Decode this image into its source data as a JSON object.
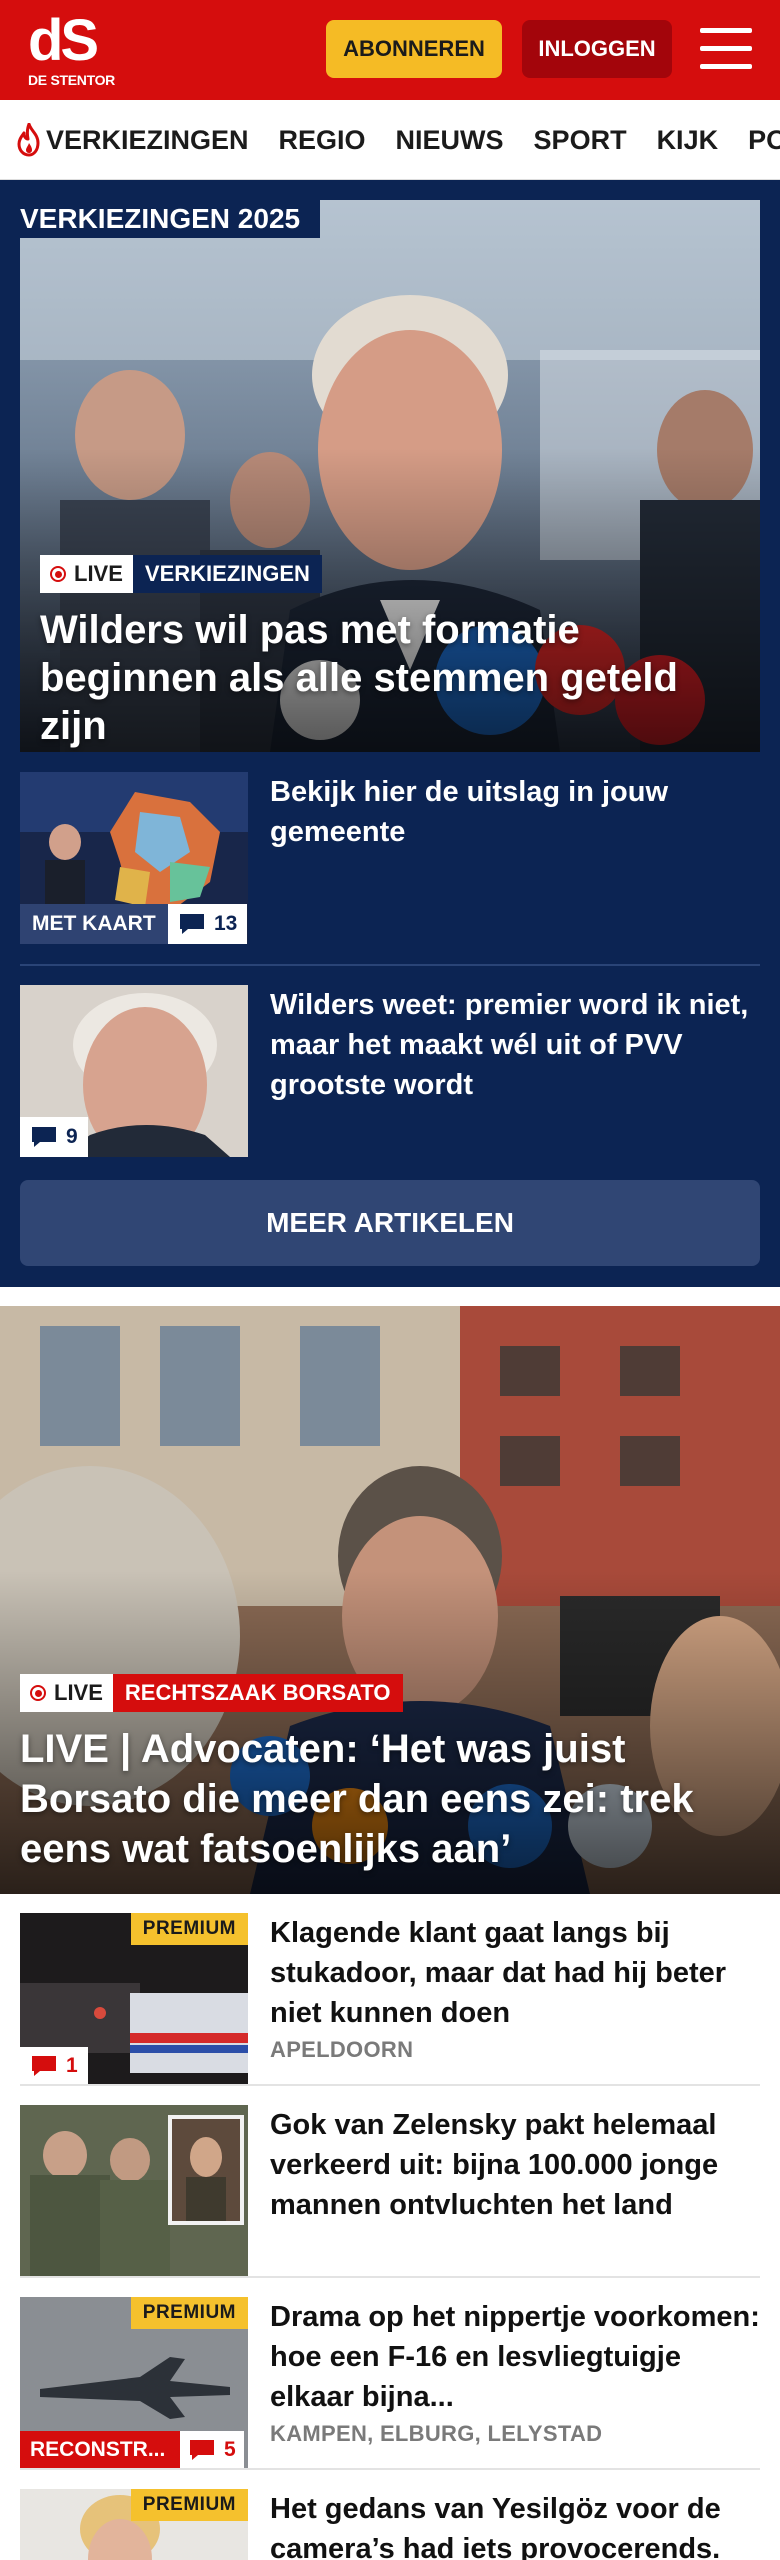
{
  "header": {
    "logo_mark": "dS",
    "logo_sub": "DE STENTOR",
    "subscribe_label": "ABONNEREN",
    "login_label": "INLOGGEN"
  },
  "nav": {
    "items": [
      "VERKIEZINGEN",
      "REGIO",
      "NIEUWS",
      "SPORT",
      "KIJK",
      "PODCAST"
    ]
  },
  "elections": {
    "label": "VERKIEZINGEN 2025",
    "hero": {
      "live": "LIVE",
      "category": "VERKIEZINGEN",
      "title": "Wilders wil pas met formatie beginnen als alle stemmen geteld zijn"
    },
    "articles": [
      {
        "title": "Bekijk hier de uitslag in jouw gemeente",
        "tag": "MET KAART",
        "comments": "13"
      },
      {
        "title": "Wilders weet: premier word ik niet, maar het maakt wél uit of PVV grootste wordt",
        "comments": "9"
      }
    ],
    "more_label": "MEER ARTIKELEN"
  },
  "hero2": {
    "live": "LIVE",
    "category": "RECHTSZAAK BORSATO",
    "title": "LIVE | Advocaten: ‘Het was juist Borsato die meer dan eens zei: trek eens wat fatsoenlijks aan’"
  },
  "list": [
    {
      "title": "Klagende klant gaat langs bij stukadoor, maar dat had hij beter niet kunnen doen",
      "meta": "APELDOORN",
      "premium": "PREMIUM",
      "comments": "1"
    },
    {
      "title": "Gok van Zelensky pakt helemaal verkeerd uit: bijna 100.000 jonge mannen ontvluchten het land"
    },
    {
      "title": "Drama op het nippertje voorkomen: hoe een F-16 en lesvliegtuigje elkaar bijna...",
      "meta": "KAMPEN, ELBURG, LELYSTAD",
      "premium": "PREMIUM",
      "tag": "RECONSTR...",
      "comments": "5"
    },
    {
      "title": "Het gedans van Yesilgöz voor de camera’s had iets provocerends.",
      "premium": "PREMIUM"
    }
  ],
  "colors": {
    "brand_red": "#d50d0d",
    "navy": "#0c2453",
    "premium_yellow": "#f5c12d",
    "subscribe_yellow": "#f5bb25"
  },
  "icons": [
    "flame-icon",
    "menu-icon",
    "comment-icon",
    "live-dot-icon"
  ]
}
